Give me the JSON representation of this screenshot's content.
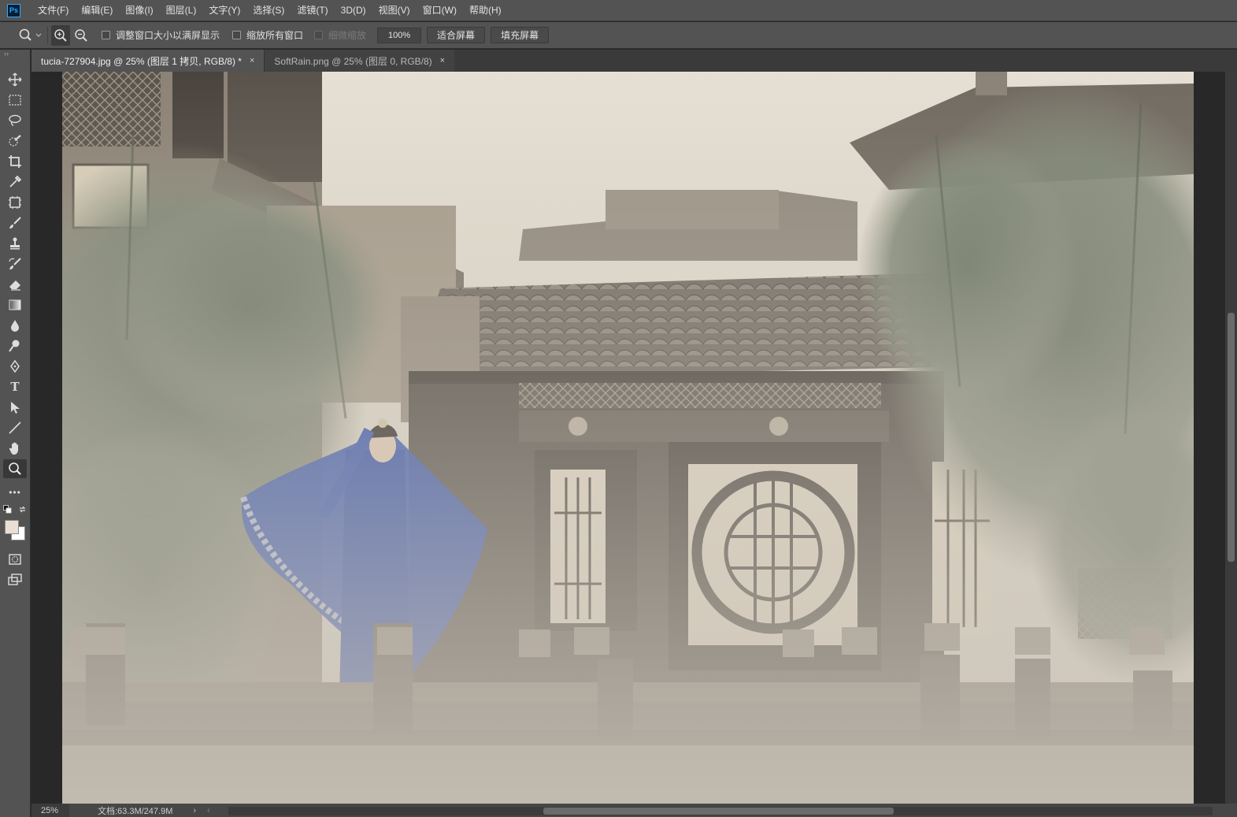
{
  "app": {
    "logo": "Ps"
  },
  "menu": [
    "文件(F)",
    "编辑(E)",
    "图像(I)",
    "图层(L)",
    "文字(Y)",
    "选择(S)",
    "滤镜(T)",
    "3D(D)",
    "视图(V)",
    "窗口(W)",
    "帮助(H)"
  ],
  "options": {
    "resize_windows": "调整窗口大小以满屏显示",
    "zoom_all": "缩放所有窗口",
    "scrubby_zoom": "细微缩放",
    "zoom_value": "100%",
    "fit_screen": "适合屏幕",
    "fill_screen": "填充屏幕"
  },
  "tools": [
    "move-icon",
    "marquee-icon",
    "lasso-icon",
    "quick-select-icon",
    "crop-icon",
    "eyedropper-icon",
    "frame-icon",
    "brush-icon",
    "stamp-icon",
    "history-brush-icon",
    "eraser-icon",
    "gradient-icon",
    "blur-icon",
    "dodge-icon",
    "pen-icon",
    "type-icon",
    "path-select-icon",
    "line-icon",
    "hand-icon",
    "zoom-icon",
    "more-icon"
  ],
  "toolbox": {
    "type_glyph": "T",
    "more_glyph": "•••"
  },
  "colors": {
    "foreground": "#eadfd2",
    "background": "#ffffff",
    "accent": "#31a8ff"
  },
  "tabs": [
    {
      "label": "tucia-727904.jpg @ 25% (图层 1 拷贝, RGB/8) *",
      "close": "×",
      "active": true
    },
    {
      "label": "SoftRain.png @ 25% (图层 0, RGB/8)",
      "close": "×",
      "active": false
    }
  ],
  "status": {
    "zoom": "25%",
    "doc": "文档:63.3M/247.9M",
    "arrow": "›",
    "scroll_left": "‹"
  }
}
